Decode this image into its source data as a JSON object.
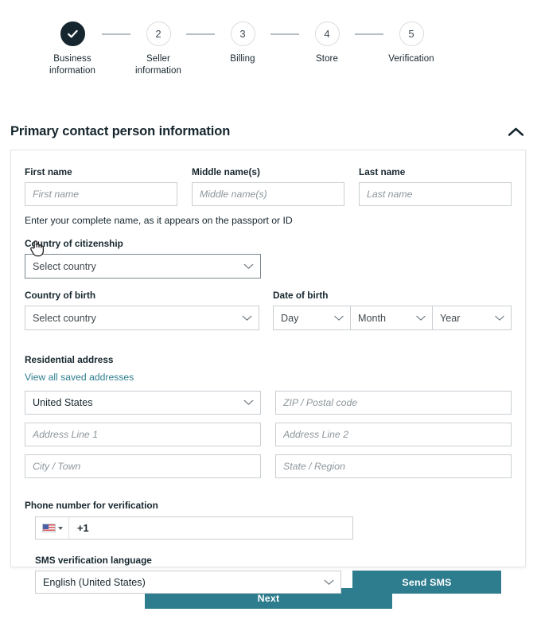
{
  "stepper": {
    "steps": [
      {
        "marker": "check",
        "label": "Business\ninformation",
        "state": "completed"
      },
      {
        "marker": "2",
        "label": "Seller\ninformation",
        "state": "pending"
      },
      {
        "marker": "3",
        "label": "Billing",
        "state": "pending"
      },
      {
        "marker": "4",
        "label": "Store",
        "state": "pending"
      },
      {
        "marker": "5",
        "label": "Verification",
        "state": "pending"
      }
    ]
  },
  "section": {
    "title": "Primary contact person information",
    "collapse_icon": "chevron-up-icon"
  },
  "form": {
    "first_name": {
      "label": "First name",
      "placeholder": "First name",
      "value": ""
    },
    "middle_name": {
      "label": "Middle name(s)",
      "placeholder": "Middle name(s)",
      "value": ""
    },
    "last_name": {
      "label": "Last name",
      "placeholder": "Last name",
      "value": ""
    },
    "name_helper": "Enter your complete name, as it appears on the passport or ID",
    "country_citizenship": {
      "label": "Country of citizenship",
      "value": "Select country"
    },
    "country_birth": {
      "label": "Country of birth",
      "value": "Select country"
    },
    "date_of_birth": {
      "label": "Date of birth",
      "day": "Day",
      "month": "Month",
      "year": "Year"
    },
    "residential_address": {
      "label": "Residential address",
      "saved_link": "View all saved addresses",
      "country": "United States",
      "zip_placeholder": "ZIP / Postal code",
      "address1_placeholder": "Address Line 1",
      "address2_placeholder": "Address Line 2",
      "city_placeholder": "City / Town",
      "state_placeholder": "State / Region"
    },
    "phone": {
      "label": "Phone number for verification",
      "flag": "us-flag-icon",
      "country_code": "+1",
      "value": ""
    },
    "sms_language": {
      "label": "SMS verification language",
      "value": "English (United States)"
    },
    "send_sms_button": "Send SMS"
  },
  "footer": {
    "next_button": "Next"
  },
  "colors": {
    "accent_teal": "#2e7d8f",
    "step_done": "#16262e",
    "text": "#16262e",
    "border": "#c9ced2"
  },
  "cursor": {
    "type": "pointer-hand-cursor"
  }
}
